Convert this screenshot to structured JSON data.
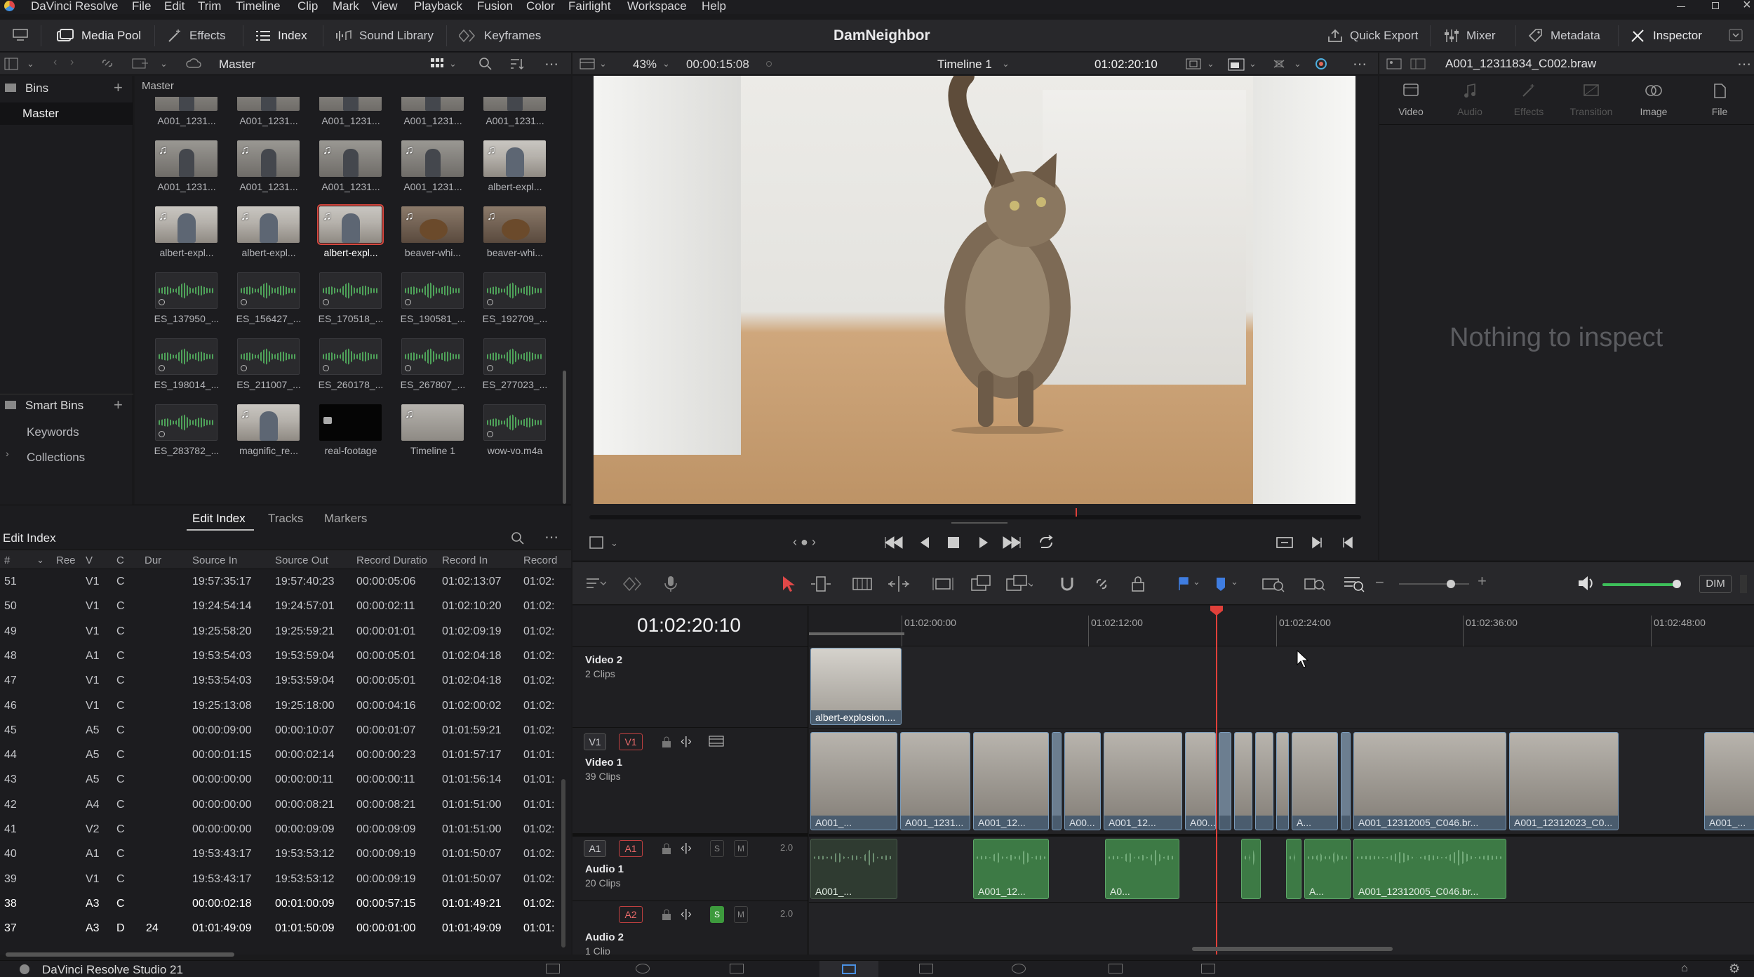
{
  "app": {
    "name": "DaVinci Resolve",
    "project_title": "DamNeighbor",
    "footer_name": "DaVinci Resolve Studio 21"
  },
  "menu": [
    "File",
    "Edit",
    "Trim",
    "Timeline",
    "Clip",
    "Mark",
    "View",
    "Playback",
    "Fusion",
    "Color",
    "Fairlight",
    "Workspace",
    "Help"
  ],
  "toolbar": {
    "media_pool": "Media Pool",
    "effects": "Effects",
    "index": "Index",
    "sound_library": "Sound Library",
    "keyframes": "Keyframes",
    "quick_export": "Quick Export",
    "mixer": "Mixer",
    "metadata": "Metadata",
    "inspector": "Inspector"
  },
  "media_pool": {
    "bin_name": "Master",
    "breadcrumb": "Master",
    "bins_label": "Bins",
    "master_bin": "Master",
    "smart_bins_label": "Smart Bins",
    "keywords": "Keywords",
    "collections": "Collections",
    "clips": [
      {
        "name": "A001_1231...",
        "kind": "gray"
      },
      {
        "name": "A001_1231...",
        "kind": "gray"
      },
      {
        "name": "A001_1231...",
        "kind": "gray"
      },
      {
        "name": "A001_1231...",
        "kind": "gray"
      },
      {
        "name": "A001_1231...",
        "kind": "gray"
      },
      {
        "name": "A001_1231...",
        "kind": "gray"
      },
      {
        "name": "A001_1231...",
        "kind": "gray"
      },
      {
        "name": "A001_1231...",
        "kind": "gray"
      },
      {
        "name": "A001_1231...",
        "kind": "gray"
      },
      {
        "name": "albert-expl...",
        "kind": "person"
      },
      {
        "name": "albert-expl...",
        "kind": "person"
      },
      {
        "name": "albert-expl...",
        "kind": "person"
      },
      {
        "name": "albert-expl...",
        "kind": "person",
        "selected": true
      },
      {
        "name": "beaver-whi...",
        "kind": "beaver"
      },
      {
        "name": "beaver-whi...",
        "kind": "beaver"
      },
      {
        "name": "ES_137950_...",
        "kind": "audio"
      },
      {
        "name": "ES_156427_...",
        "kind": "audio"
      },
      {
        "name": "ES_170518_...",
        "kind": "audio"
      },
      {
        "name": "ES_190581_...",
        "kind": "audio"
      },
      {
        "name": "ES_192709_...",
        "kind": "audio"
      },
      {
        "name": "ES_198014_...",
        "kind": "audio"
      },
      {
        "name": "ES_211007_...",
        "kind": "audio"
      },
      {
        "name": "ES_260178_...",
        "kind": "audio"
      },
      {
        "name": "ES_267807_...",
        "kind": "audio"
      },
      {
        "name": "ES_277023_...",
        "kind": "audio"
      },
      {
        "name": "ES_283782_...",
        "kind": "audio"
      },
      {
        "name": "magnific_re...",
        "kind": "person"
      },
      {
        "name": "real-footage",
        "kind": "black"
      },
      {
        "name": "Timeline 1",
        "kind": "timeline"
      },
      {
        "name": "wow-vo.m4a",
        "kind": "audio"
      }
    ]
  },
  "index_tabs": [
    "Edit Index",
    "Tracks",
    "Markers"
  ],
  "edit_index": {
    "title": "Edit Index",
    "columns": [
      "#",
      "Ree",
      "V",
      "C",
      "Dur",
      "Source In",
      "Source Out",
      "Record Duratio",
      "Record In",
      "Record"
    ],
    "rows": [
      [
        "51",
        "",
        "V1",
        "C",
        "",
        "19:57:35:17",
        "19:57:40:23",
        "00:00:05:06",
        "01:02:13:07",
        "01:02:"
      ],
      [
        "50",
        "",
        "V1",
        "C",
        "",
        "19:24:54:14",
        "19:24:57:01",
        "00:00:02:11",
        "01:02:10:20",
        "01:02:"
      ],
      [
        "49",
        "",
        "V1",
        "C",
        "",
        "19:25:58:20",
        "19:25:59:21",
        "00:00:01:01",
        "01:02:09:19",
        "01:02:"
      ],
      [
        "48",
        "",
        "A1",
        "C",
        "",
        "19:53:54:03",
        "19:53:59:04",
        "00:00:05:01",
        "01:02:04:18",
        "01:02:"
      ],
      [
        "47",
        "",
        "V1",
        "C",
        "",
        "19:53:54:03",
        "19:53:59:04",
        "00:00:05:01",
        "01:02:04:18",
        "01:02:"
      ],
      [
        "46",
        "",
        "V1",
        "C",
        "",
        "19:25:13:08",
        "19:25:18:00",
        "00:00:04:16",
        "01:02:00:02",
        "01:02:"
      ],
      [
        "45",
        "",
        "A5",
        "C",
        "",
        "00:00:09:00",
        "00:00:10:07",
        "00:00:01:07",
        "01:01:59:21",
        "01:02:"
      ],
      [
        "44",
        "",
        "A5",
        "C",
        "",
        "00:00:01:15",
        "00:00:02:14",
        "00:00:00:23",
        "01:01:57:17",
        "01:01:"
      ],
      [
        "43",
        "",
        "A5",
        "C",
        "",
        "00:00:00:00",
        "00:00:00:11",
        "00:00:00:11",
        "01:01:56:14",
        "01:01:"
      ],
      [
        "42",
        "",
        "A4",
        "C",
        "",
        "00:00:00:00",
        "00:00:08:21",
        "00:00:08:21",
        "01:01:51:00",
        "01:01:"
      ],
      [
        "41",
        "",
        "V2",
        "C",
        "",
        "00:00:00:00",
        "00:00:09:09",
        "00:00:09:09",
        "01:01:51:00",
        "01:02:"
      ],
      [
        "40",
        "",
        "A1",
        "C",
        "",
        "19:53:43:17",
        "19:53:53:12",
        "00:00:09:19",
        "01:01:50:07",
        "01:02:"
      ],
      [
        "39",
        "",
        "V1",
        "C",
        "",
        "19:53:43:17",
        "19:53:53:12",
        "00:00:09:19",
        "01:01:50:07",
        "01:02:"
      ],
      [
        "38",
        "",
        "A3",
        "C",
        "",
        "00:00:02:18",
        "00:01:00:09",
        "00:00:57:15",
        "01:01:49:21",
        "01:02:"
      ],
      [
        "37",
        "",
        "A3",
        "D",
        "24",
        "01:01:49:09",
        "01:01:50:09",
        "00:00:01:00",
        "01:01:49:09",
        "01:01:"
      ]
    ]
  },
  "viewer": {
    "zoom": "43%",
    "source_tc": "00:00:15:08",
    "timeline_name": "Timeline 1",
    "record_tc": "01:02:20:10",
    "playhead_fraction": 0.63
  },
  "inspector": {
    "clip_name": "A001_12311834_C002.braw",
    "tabs": [
      "Video",
      "Audio",
      "Effects",
      "Transition",
      "Image",
      "File"
    ],
    "empty": "Nothing to inspect"
  },
  "timeline": {
    "timecode": "01:02:20:10",
    "ruler": [
      "01:02:00:00",
      "01:02:12:00",
      "01:02:24:00",
      "01:02:36:00",
      "01:02:48:00"
    ],
    "dim": "DIM",
    "tracks": {
      "v2": {
        "name": "Video 2",
        "count": "2 Clips"
      },
      "v1": {
        "name": "Video 1",
        "count": "39 Clips",
        "btn_a": "V1",
        "btn_b": "V1"
      },
      "a1": {
        "name": "Audio 1",
        "count": "20 Clips",
        "btn_a": "A1",
        "btn_b": "A1",
        "level": "2.0",
        "s": "S",
        "m": "M"
      },
      "a2": {
        "name": "Audio 2",
        "count": "1 Clip",
        "btn_b": "A2",
        "level": "2.0",
        "s": "S",
        "m": "M"
      }
    },
    "v2_clips": [
      "albert-explosion...."
    ],
    "v1_clips": [
      "A001_...",
      "A001_1231...",
      "A001_12...",
      "A00...",
      "A001_12...",
      "A00...",
      "A...",
      "A001_12312005_C046.br...",
      "A001_12312023_C0...",
      "A001_..."
    ],
    "a1_clips": [
      "A001_...",
      "A001_12...",
      "A0...",
      "A...",
      "A001_12312005_C046.br..."
    ]
  },
  "colors": {
    "accent_red": "#d9483f",
    "video_clip": "#4a5c6e",
    "audio_clip": "#3d7a45",
    "playhead": "#e0403a"
  }
}
